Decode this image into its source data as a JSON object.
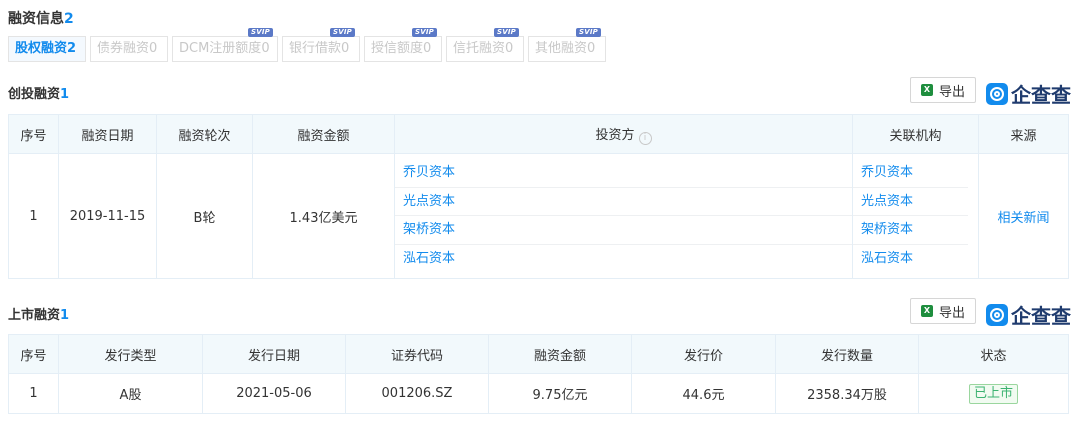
{
  "header": {
    "title": "融资信息",
    "count": "2"
  },
  "tabs": [
    {
      "label": "股权融资",
      "count": "2",
      "svip": ""
    },
    {
      "label": "债券融资",
      "count": "0",
      "svip": ""
    },
    {
      "label": "DCM注册额度",
      "count": "0",
      "svip": "SVIP"
    },
    {
      "label": "银行借款",
      "count": "0",
      "svip": "SVIP"
    },
    {
      "label": "授信额度",
      "count": "0",
      "svip": "SVIP"
    },
    {
      "label": "信托融资",
      "count": "0",
      "svip": "SVIP"
    },
    {
      "label": "其他融资",
      "count": "0",
      "svip": "SVIP"
    }
  ],
  "export_label": "导出",
  "brand_text": "企查查",
  "venture": {
    "title": "创投融资",
    "count": "1",
    "columns": [
      "序号",
      "融资日期",
      "融资轮次",
      "融资金额",
      "投资方",
      "关联机构",
      "来源"
    ],
    "row": {
      "index": "1",
      "date": "2019-11-15",
      "round": "B轮",
      "amount": "1.43亿美元",
      "investors": [
        "乔贝资本",
        "光点资本",
        "架桥资本",
        "泓石资本"
      ],
      "orgs": [
        "乔贝资本",
        "光点资本",
        "架桥资本",
        "泓石资本"
      ],
      "source": "相关新闻"
    }
  },
  "listing": {
    "title": "上市融资",
    "count": "1",
    "columns": [
      "序号",
      "发行类型",
      "发行日期",
      "证券代码",
      "融资金额",
      "发行价",
      "发行数量",
      "状态"
    ],
    "row": {
      "index": "1",
      "type": "A股",
      "date": "2021-05-06",
      "code": "001206.SZ",
      "amount": "9.75亿元",
      "price": "44.6元",
      "quantity": "2358.34万股",
      "status": "已上市"
    }
  },
  "colors": {
    "accent": "#128bed",
    "header_bg": "#f2f9fc",
    "svip": "#5b79c7",
    "status_green": "#3cb371"
  }
}
